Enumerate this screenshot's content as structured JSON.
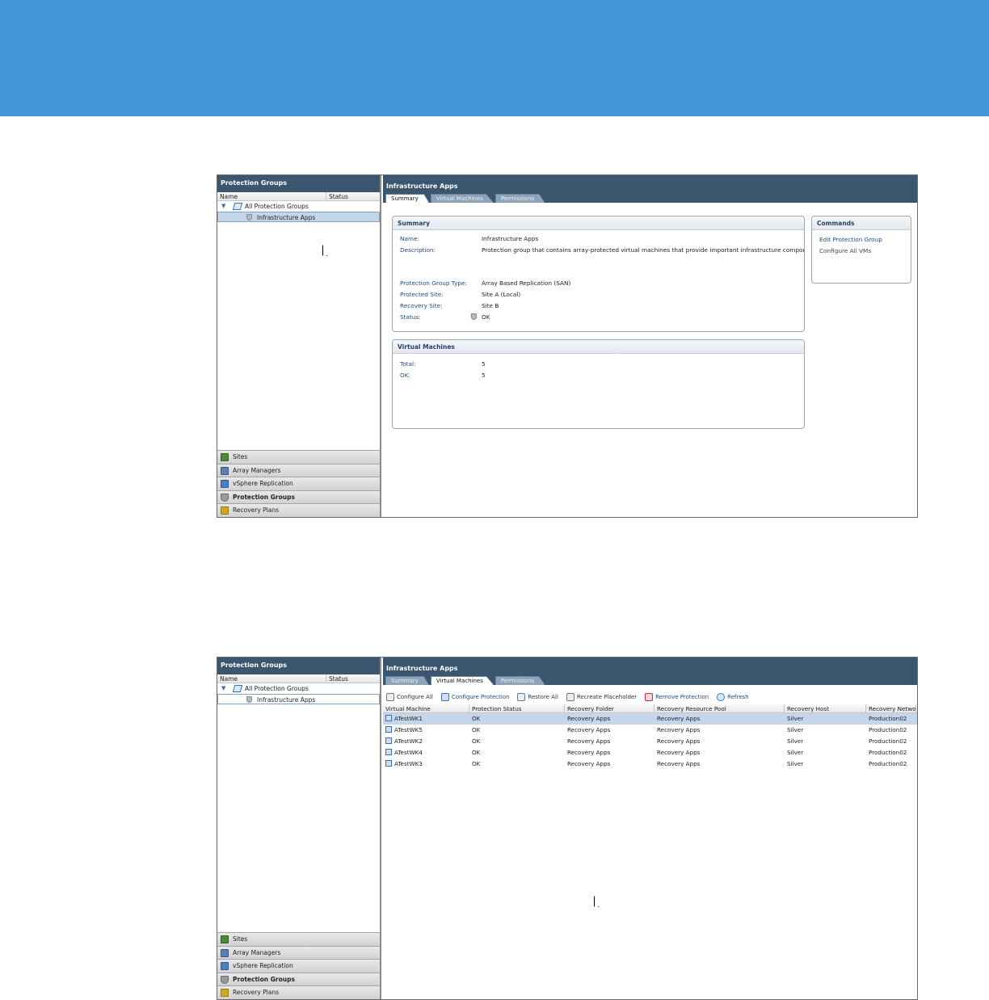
{
  "colors": {
    "banner": "#4495d7",
    "header": "#3b566f",
    "selection": "#c4d6ea",
    "link": "#1f4a86"
  },
  "left_pane": {
    "title": "Protection Groups",
    "columns": [
      "Name",
      "Status"
    ],
    "tree": [
      {
        "label": "All Protection Groups",
        "icon": "protection-group-folder-icon"
      },
      {
        "label": "Infrastructure Apps",
        "icon": "shield-icon"
      }
    ],
    "nav": [
      {
        "label": "Sites",
        "icon": "sites-icon",
        "color": "#4a8a3a"
      },
      {
        "label": "Array Managers",
        "icon": "array-manager-icon",
        "color": "#5b7fb0"
      },
      {
        "label": "vSphere Replication",
        "icon": "replication-icon",
        "color": "#4a7fc0"
      },
      {
        "label": "Protection Groups",
        "icon": "shield-icon",
        "color": "#9a9a9a"
      },
      {
        "label": "Recovery Plans",
        "icon": "recovery-plan-icon",
        "color": "#d0a820"
      }
    ]
  },
  "screen1": {
    "title": "Infrastructure Apps",
    "tabs": [
      "Summary",
      "Virtual Machines",
      "Permissions"
    ],
    "summary": {
      "title": "Summary",
      "name_label": "Name:",
      "name_value": "Infrastructure Apps",
      "description_label": "Description:",
      "description_value": "Protection group that contains array-protected virtual machines that provide important infrastructure components.",
      "type_label": "Protection Group Type:",
      "type_value": "Array Based Replication (SAN)",
      "protected_label": "Protected Site:",
      "protected_value": "Site A (Local)",
      "recovery_label": "Recovery Site:",
      "recovery_value": "Site B",
      "status_label": "Status:",
      "status_value": "OK"
    },
    "vms": {
      "title": "Virtual Machines",
      "total_label": "Total:",
      "total_value": "5",
      "ok_label": "OK:",
      "ok_value": "5"
    },
    "commands": {
      "title": "Commands",
      "edit": "Edit Protection Group",
      "configure_all": "Configure All VMs"
    }
  },
  "screen2": {
    "title": "Infrastructure Apps",
    "tabs": [
      "Summary",
      "Virtual Machines",
      "Permissions"
    ],
    "toolbar": [
      "Configure All",
      "Configure Protection",
      "Restore All",
      "Recreate Placeholder",
      "Remove Protection",
      "Refresh"
    ],
    "columns": [
      "Virtual Machine",
      "Protection Status",
      "Recovery Folder",
      "Recovery Resource Pool",
      "Recovery Host",
      "Recovery Network"
    ],
    "rows": [
      [
        "ATestWK1",
        "OK",
        "Recovery Apps",
        "Recovery Apps",
        "Silver",
        "Production02"
      ],
      [
        "ATestWK5",
        "OK",
        "Recovery Apps",
        "Recovery Apps",
        "Silver",
        "Production02"
      ],
      [
        "ATestWK2",
        "OK",
        "Recovery Apps",
        "Recovery Apps",
        "Silver",
        "Production02"
      ],
      [
        "ATestWK4",
        "OK",
        "Recovery Apps",
        "Recovery Apps",
        "Silver",
        "Production02"
      ],
      [
        "ATestWK3",
        "OK",
        "Recovery Apps",
        "Recovery Apps",
        "Silver",
        "Production02"
      ]
    ]
  }
}
